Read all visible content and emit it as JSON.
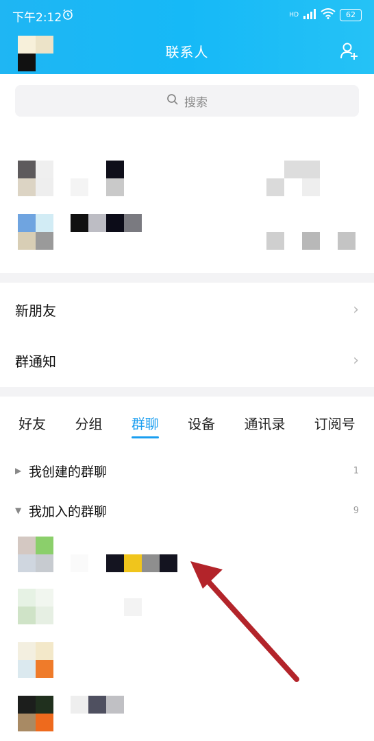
{
  "status_bar": {
    "time": "下午2:12",
    "battery": "62",
    "network": "HD"
  },
  "header": {
    "title": "联系人"
  },
  "search": {
    "placeholder": "搜索"
  },
  "menu": [
    {
      "label": "新朋友"
    },
    {
      "label": "群通知"
    }
  ],
  "tabs": [
    {
      "label": "好友",
      "active": false
    },
    {
      "label": "分组",
      "active": false
    },
    {
      "label": "群聊",
      "active": true
    },
    {
      "label": "设备",
      "active": false
    },
    {
      "label": "通讯录",
      "active": false
    },
    {
      "label": "订阅号",
      "active": false
    }
  ],
  "groups": [
    {
      "label": "我创建的群聊",
      "count": "1",
      "expanded": false
    },
    {
      "label": "我加入的群聊",
      "count": "9",
      "expanded": true
    }
  ],
  "colors": {
    "header_bg": "#1fb6f3",
    "accent": "#1a9ef0",
    "arrow": "#b3242a"
  }
}
